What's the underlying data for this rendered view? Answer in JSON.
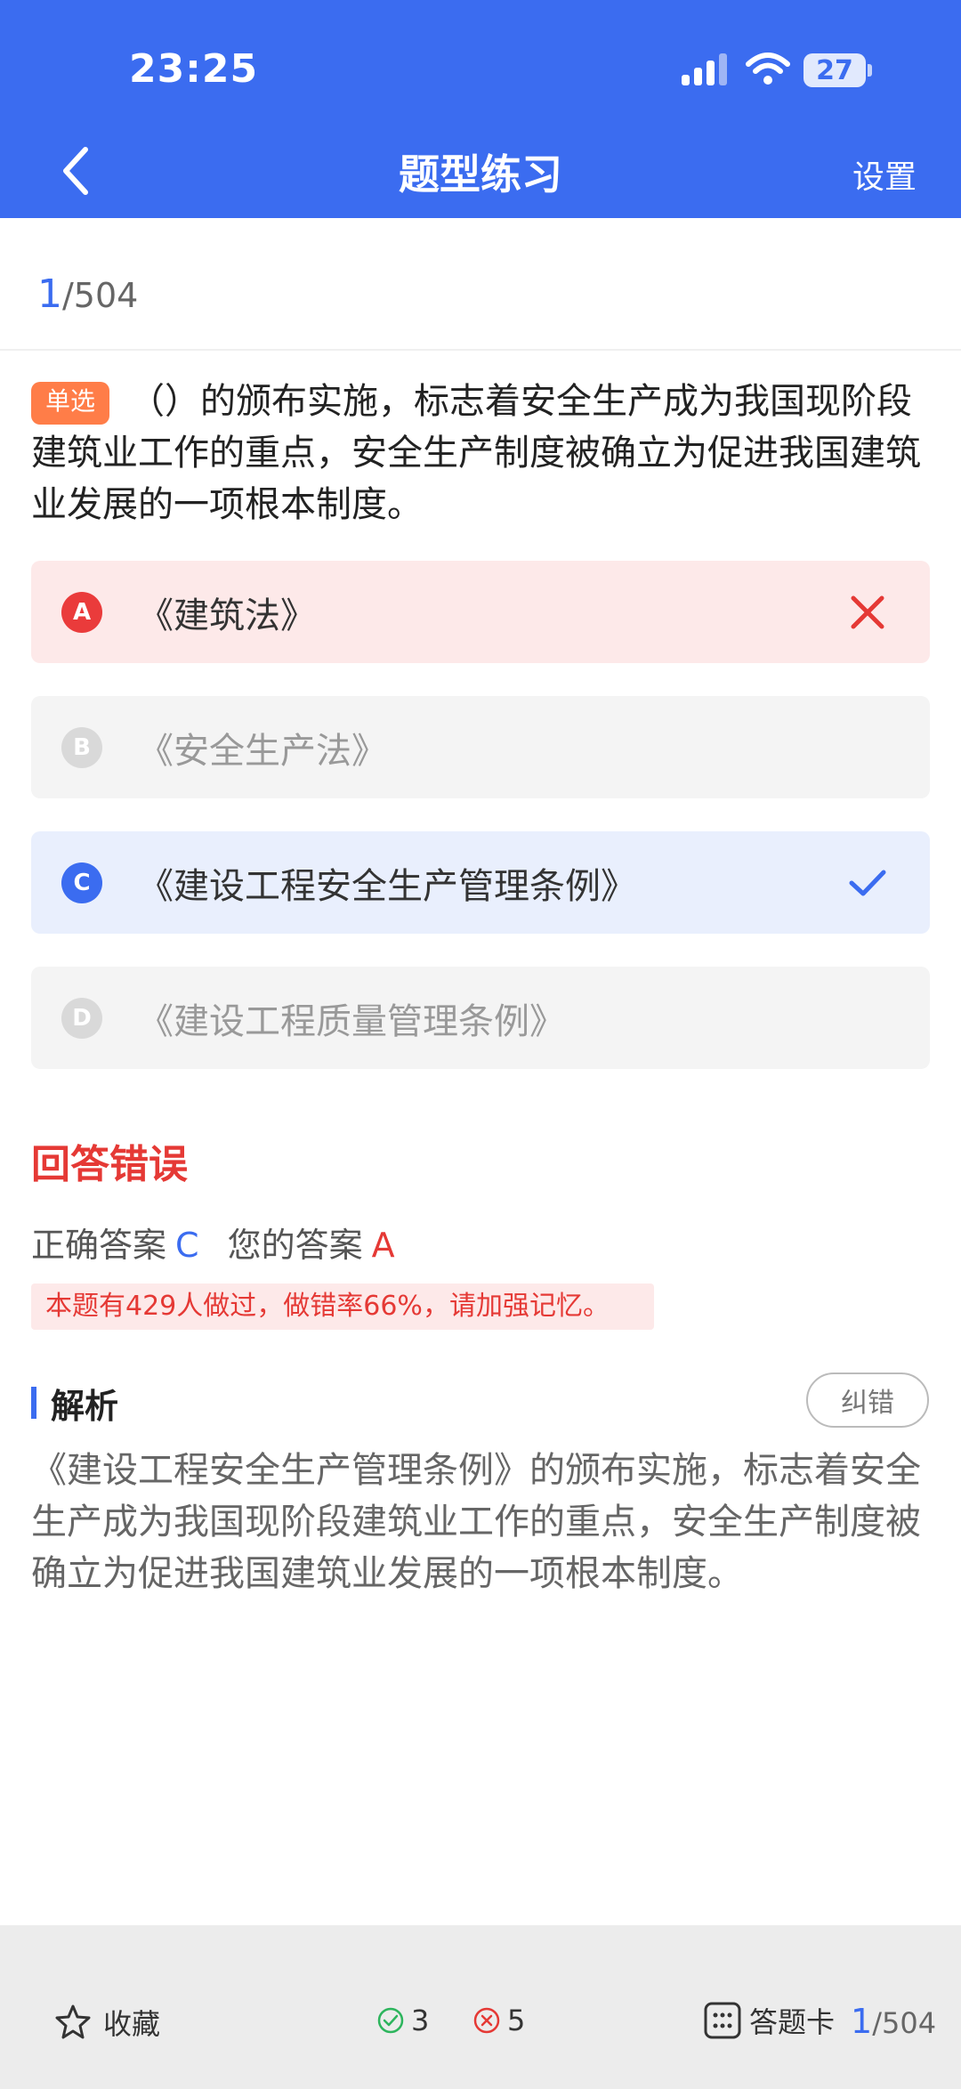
{
  "status_bar": {
    "time": "23:25",
    "battery": "27"
  },
  "header": {
    "title": "题型练习",
    "settings_label": "设置"
  },
  "progress": {
    "current": "1",
    "total": "/504"
  },
  "question": {
    "tag": "单选",
    "text": "（）的颁布实施，标志着安全生产成为我国现阶段建筑业工作的重点，安全生产制度被确立为促进我国建筑业发展的一项根本制度。"
  },
  "options": [
    {
      "letter": "A",
      "text": "《建筑法》",
      "state": "wrong"
    },
    {
      "letter": "B",
      "text": "《安全生产法》",
      "state": "dim"
    },
    {
      "letter": "C",
      "text": "《建设工程安全生产管理条例》",
      "state": "right"
    },
    {
      "letter": "D",
      "text": "《建设工程质量管理条例》",
      "state": "dim"
    }
  ],
  "result": {
    "title": "回答错误",
    "correct_label": "正确答案",
    "correct_value": "C",
    "your_label": "您的答案",
    "your_value": "A",
    "stat": "本题有429人做过，做错率66%，请加强记忆。"
  },
  "analysis": {
    "title": "解析",
    "report_label": "纠错",
    "text": "《建设工程安全生产管理条例》的颁布实施，标志着安全生产成为我国现阶段建筑业工作的重点，安全生产制度被确立为促进我国建筑业发展的一项根本制度。"
  },
  "bottom": {
    "favorite_label": "收藏",
    "correct_count": "3",
    "wrong_count": "5",
    "answer_card_label": "答题卡",
    "current": "1",
    "total": "/504"
  },
  "colors": {
    "primary": "#3b6cf0",
    "error": "#e53935",
    "tag": "#ff7d48"
  }
}
